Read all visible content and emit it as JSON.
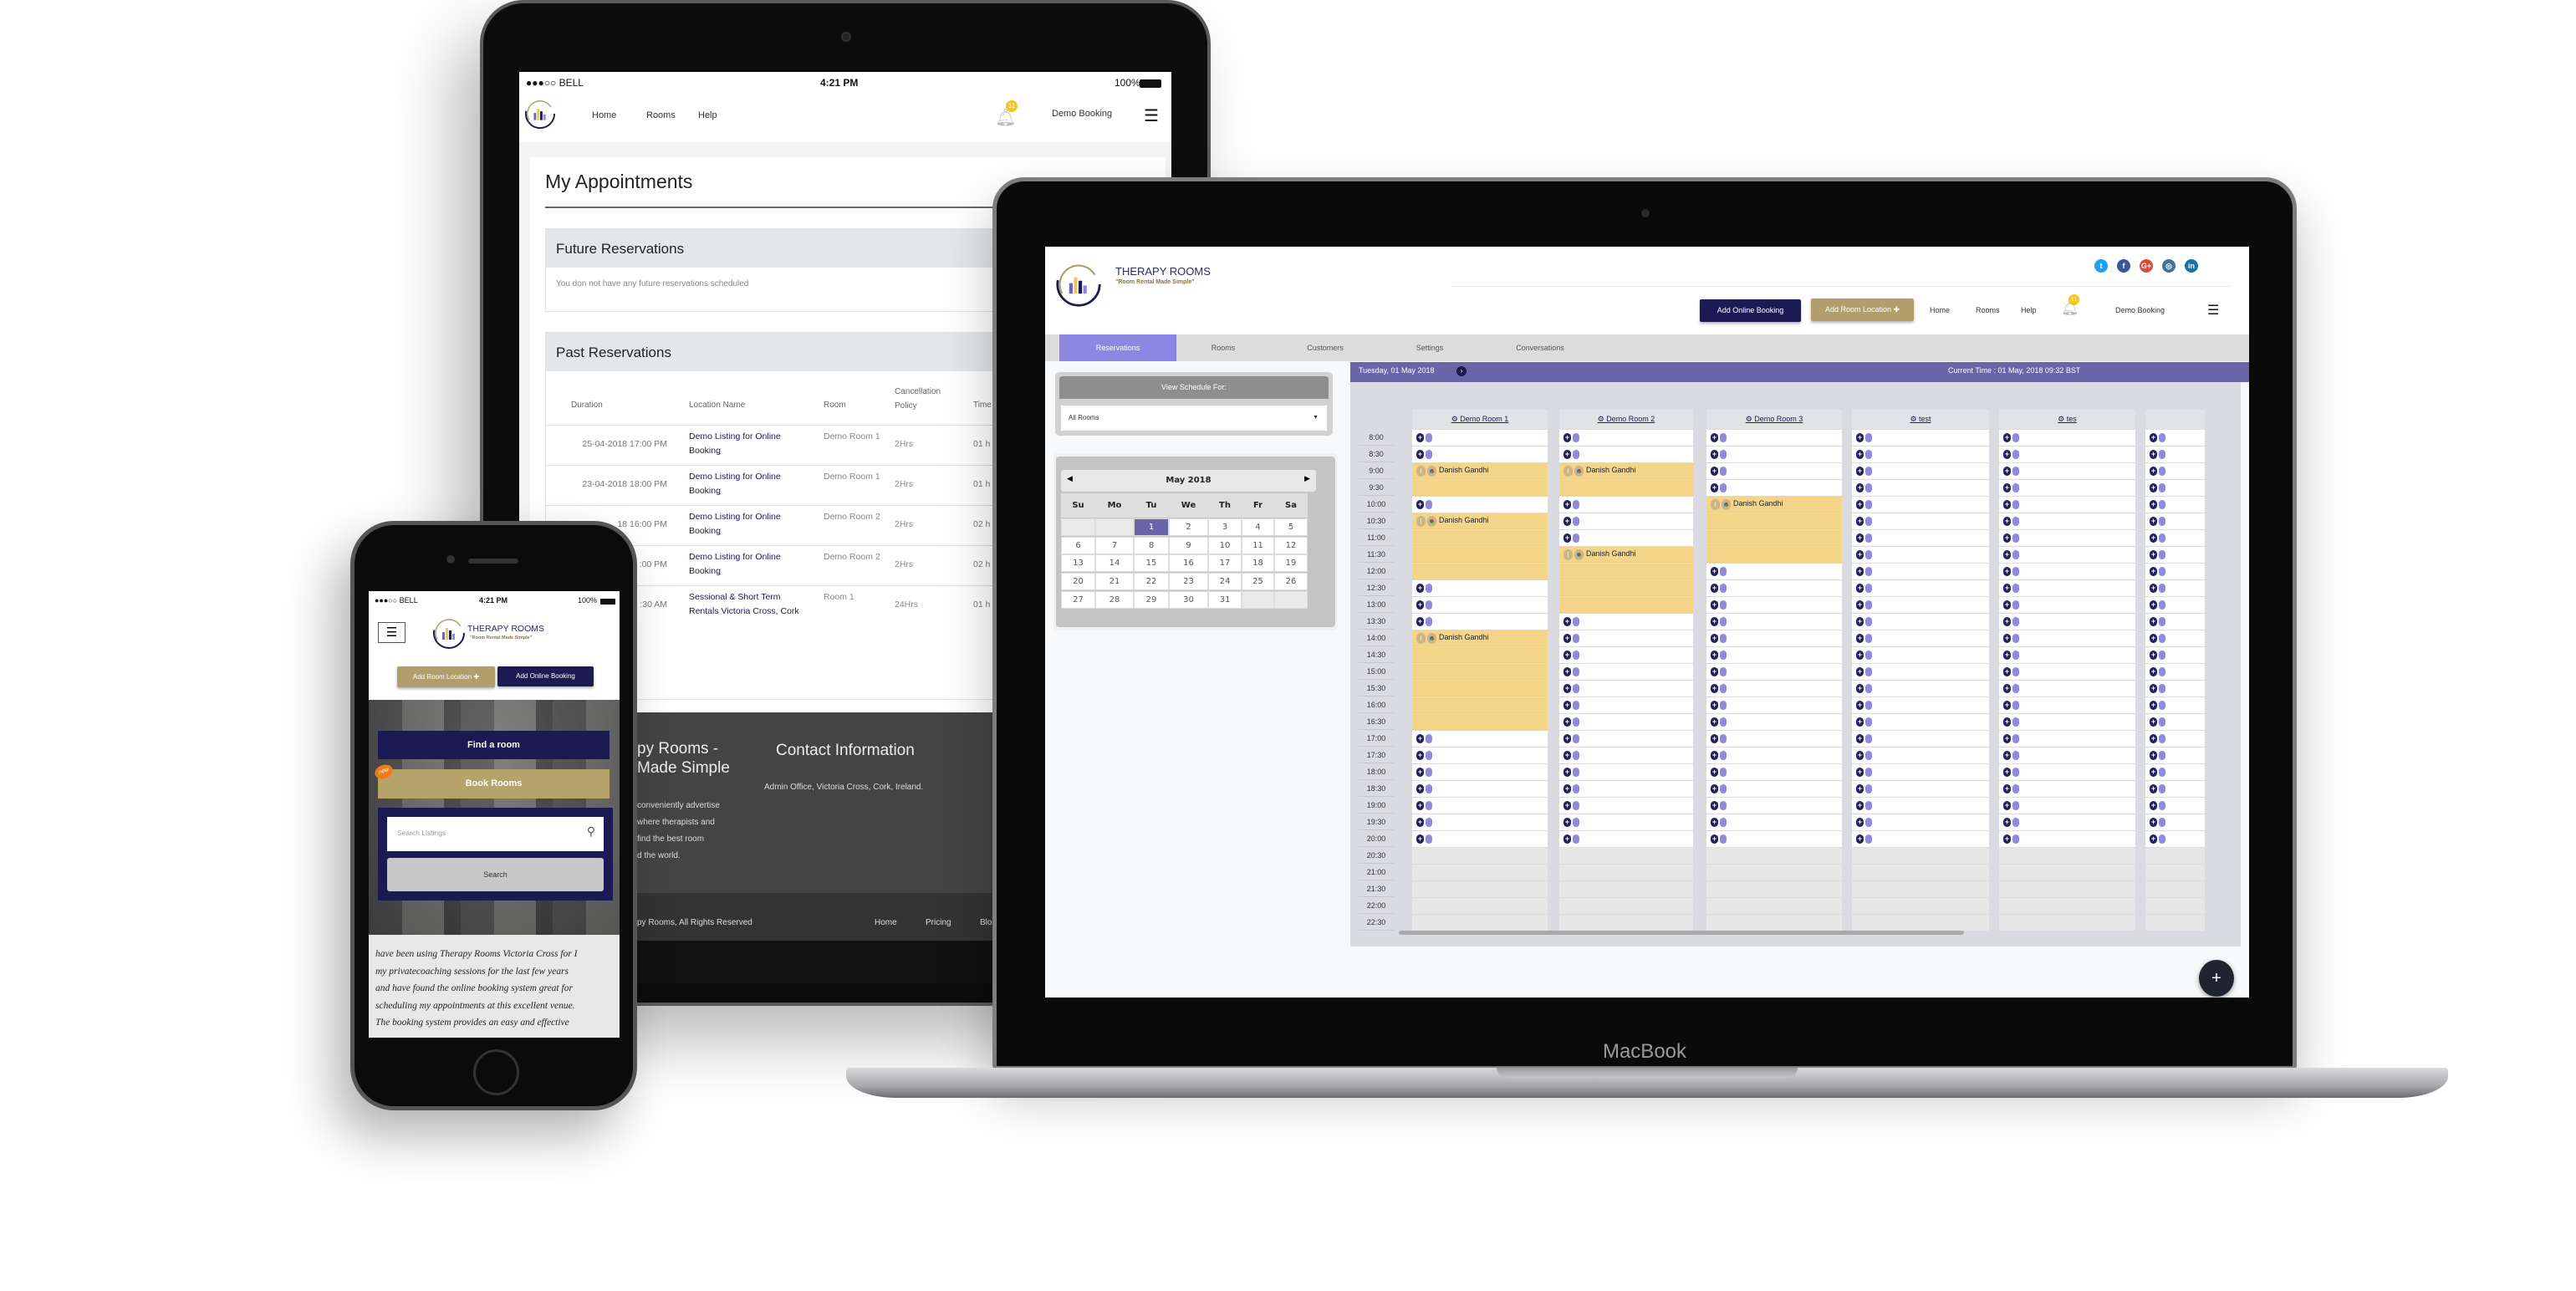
{
  "tablet": {
    "status": {
      "carrier": "●●●○○ BELL",
      "time": "4:21 PM",
      "battery": "100%"
    },
    "nav": {
      "home": "Home",
      "rooms": "Rooms",
      "help": "Help",
      "badge": "11",
      "user": "Demo Booking"
    },
    "title": "My Appointments",
    "future": {
      "title": "Future Reservations",
      "empty": "You don not have any future reservations scheduled"
    },
    "past": {
      "title": "Past Reservations",
      "columns": [
        "Duration",
        "Location Name",
        "Room",
        "Cancellation Policy",
        "Time"
      ],
      "rows": [
        [
          "25-04-2018 17:00 PM",
          "Demo Listing for Online Booking",
          "Demo Room 1",
          "2Hrs",
          "01 h"
        ],
        [
          "23-04-2018 18:00 PM",
          "Demo Listing for Online Booking",
          "Demo Room 1",
          "2Hrs",
          "01 h"
        ],
        [
          "18 16:00 PM",
          "Demo Listing for Online Booking",
          "Demo Room 2",
          "2Hrs",
          "02 h"
        ],
        [
          ":00 PM",
          "Demo Listing for Online Booking",
          "Demo Room 2",
          "2Hrs",
          "02 h"
        ],
        [
          ":30 AM",
          "Sessional & Short Term Rentals Victoria Cross, Cork",
          "Room 1",
          "24Hrs",
          "01 h"
        ]
      ]
    },
    "footer": {
      "brand_line1": "py Rooms -",
      "brand_line2": "Made Simple",
      "desc": [
        "conveniently advertise",
        "where therapists and",
        "find the best room",
        "d the world."
      ],
      "contact_title": "Contact Information",
      "address": "Admin Office, Victoria Cross, Cork, Ireland.",
      "copyright": "py Rooms, All Rights Reserved",
      "links": [
        "Home",
        "Pricing",
        "Blog"
      ]
    }
  },
  "laptop": {
    "brand": {
      "name": "THERAPY ROOMS",
      "tagline": "\"Room Rental Made Simple\""
    },
    "social": [
      {
        "icon": "twitter-icon",
        "glyph": "t",
        "color": "#1da1f2"
      },
      {
        "icon": "facebook-icon",
        "glyph": "f",
        "color": "#3b5998"
      },
      {
        "icon": "google-plus-icon",
        "glyph": "G+",
        "color": "#dd4b39"
      },
      {
        "icon": "instagram-icon",
        "glyph": "◎",
        "color": "#3f729b"
      },
      {
        "icon": "linkedin-icon",
        "glyph": "in",
        "color": "#0e76a8"
      }
    ],
    "buttons": {
      "add_online_booking": "Add Online Booking",
      "add_room_location": "Add Room Location ✚"
    },
    "nav": {
      "home": "Home",
      "rooms": "Rooms",
      "help": "Help",
      "badge": "11",
      "user": "Demo Booking"
    },
    "tabs": [
      "Reservations",
      "Rooms",
      "Customers",
      "Settings",
      "Conversations"
    ],
    "active_tab": "Reservations",
    "schedule_for": {
      "label": "View Schedule For:",
      "value": "All Rooms"
    },
    "calendar": {
      "month": "May 2018",
      "weekdays": [
        "Su",
        "Mo",
        "Tu",
        "We",
        "Th",
        "Fr",
        "Sa"
      ],
      "weeks": [
        [
          null,
          null,
          1,
          2,
          3,
          4,
          5
        ],
        [
          6,
          7,
          8,
          9,
          10,
          11,
          12
        ],
        [
          13,
          14,
          15,
          16,
          17,
          18,
          19
        ],
        [
          20,
          21,
          22,
          23,
          24,
          25,
          26
        ],
        [
          27,
          28,
          29,
          30,
          31,
          null,
          null
        ]
      ],
      "selected": 1
    },
    "schedule": {
      "date": "Tuesday, 01 May 2018",
      "current_time": "Current Time : 01 May, 2018 09:32 BST",
      "rooms": [
        "Demo Room 1",
        "Demo Room 2",
        "Demo Room 3",
        "test",
        "tes",
        ""
      ],
      "times": [
        "8:00",
        "8:30",
        "9:00",
        "9:30",
        "10:00",
        "10:30",
        "11:00",
        "11:30",
        "12:00",
        "12:30",
        "13:00",
        "13:30",
        "14:00",
        "14:30",
        "15:00",
        "15:30",
        "16:00",
        "16:30",
        "17:00",
        "17:30",
        "18:00",
        "18:30",
        "19:00",
        "19:30",
        "20:00",
        "20:30",
        "21:00",
        "21:30",
        "22:00",
        "22:30"
      ],
      "unavailable_from": "20:30",
      "bookings": [
        {
          "room": "Demo Room 1",
          "start": "9:00",
          "end": "10:00",
          "name": "Danish Gandhi"
        },
        {
          "room": "Demo Room 1",
          "start": "10:30",
          "end": "12:30",
          "name": "Danish Gandhi"
        },
        {
          "room": "Demo Room 1",
          "start": "14:00",
          "end": "17:00",
          "name": "Danish Gandhi"
        },
        {
          "room": "Demo Room 2",
          "start": "9:00",
          "end": "10:00",
          "name": "Danish Gandhi"
        },
        {
          "room": "Demo Room 2",
          "start": "11:30",
          "end": "13:30",
          "name": "Danish Gandhi"
        },
        {
          "room": "Demo Room 3",
          "start": "10:00",
          "end": "12:00",
          "name": "Danish Gandhi"
        }
      ]
    },
    "fab": "+",
    "device_label": "MacBook"
  },
  "phone": {
    "status": {
      "carrier": "●●●○○ BELL",
      "time": "4:21 PM",
      "battery": "100%"
    },
    "brand": {
      "name": "THERAPY ROOMS",
      "tagline": "\"Room Rental Made Simple\""
    },
    "buttons": {
      "add_room_location": "Add Room Location ✚",
      "add_online_booking": "Add Online Booking"
    },
    "find_room": "Find a room",
    "book_rooms": "Book Rooms",
    "new_badge": "new",
    "search_placeholder": "Search Listings",
    "search_button": "Search",
    "testimonial": [
      " have been using Therapy Rooms Victoria Cross for I",
      "my privatecoaching sessions for the last few years",
      "and have found the online booking system great for",
      "scheduling my appointments at this excellent venue.",
      "The booking system provides an easy and effective"
    ]
  },
  "colors": {
    "navy": "#1b1a52",
    "gold": "#b19e6a",
    "purple_bar": "#6865a8",
    "active_tab": "#8c87e2",
    "booking": "#f4d58a"
  }
}
